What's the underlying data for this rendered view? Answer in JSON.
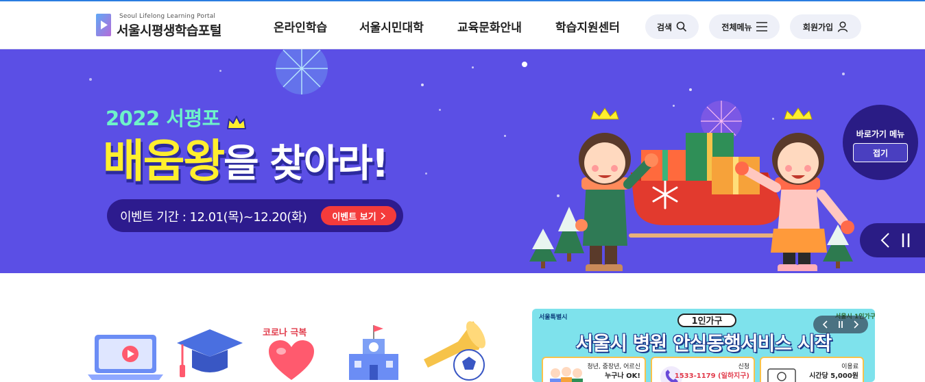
{
  "header": {
    "logo": {
      "en": "Seoul Lifelong Learning Portal",
      "ko": "서울시평생학습포털"
    },
    "nav": [
      {
        "label": "온라인학습"
      },
      {
        "label": "서울시민대학"
      },
      {
        "label": "교육문화안내"
      },
      {
        "label": "학습지원센터"
      }
    ],
    "utilities": {
      "search": {
        "label": "검색",
        "icon": "search-icon"
      },
      "menu": {
        "label": "전체메뉴",
        "icon": "hamburger-icon"
      },
      "signup": {
        "label": "회원가입",
        "icon": "user-icon"
      }
    }
  },
  "banner": {
    "year_line": "2022 서평포",
    "title_highlight": "배움왕",
    "title_rest": "을 찾아라!",
    "period": "이벤트 기간 : 12.01(목)~12.20(화)",
    "event_button": "이벤트 보기",
    "quick_menu": {
      "title": "바로가기 메뉴",
      "button": "접기"
    },
    "controls": {
      "prev_icon": "chevron-left-icon",
      "pause_icon": "pause-icon"
    },
    "colors": {
      "background": "#5b4fe5",
      "accent_yellow": "#ffef2e",
      "accent_mint": "#6ef3c9",
      "button_red": "#f43b3b"
    }
  },
  "quick_icons": [
    {
      "name": "video-lecture-icon"
    },
    {
      "name": "graduation-cap-icon"
    },
    {
      "name": "heart-icon",
      "label": "코로나 극복"
    },
    {
      "name": "school-building-icon"
    },
    {
      "name": "trumpet-ball-icon"
    }
  ],
  "promo": {
    "org": "서울특별시",
    "tag": "1인가구",
    "title": "서울시 병원 안심동행서비스 시작",
    "corner": "서울시 1인가구",
    "cards": [
      {
        "line1": "청년, 중장년, 어르신",
        "line2": "누구나 OK!"
      },
      {
        "line1": "신청",
        "line2": "1533-1179 (일하지구)"
      },
      {
        "line1": "이용료",
        "line2": "시간당 5,000원"
      }
    ]
  }
}
